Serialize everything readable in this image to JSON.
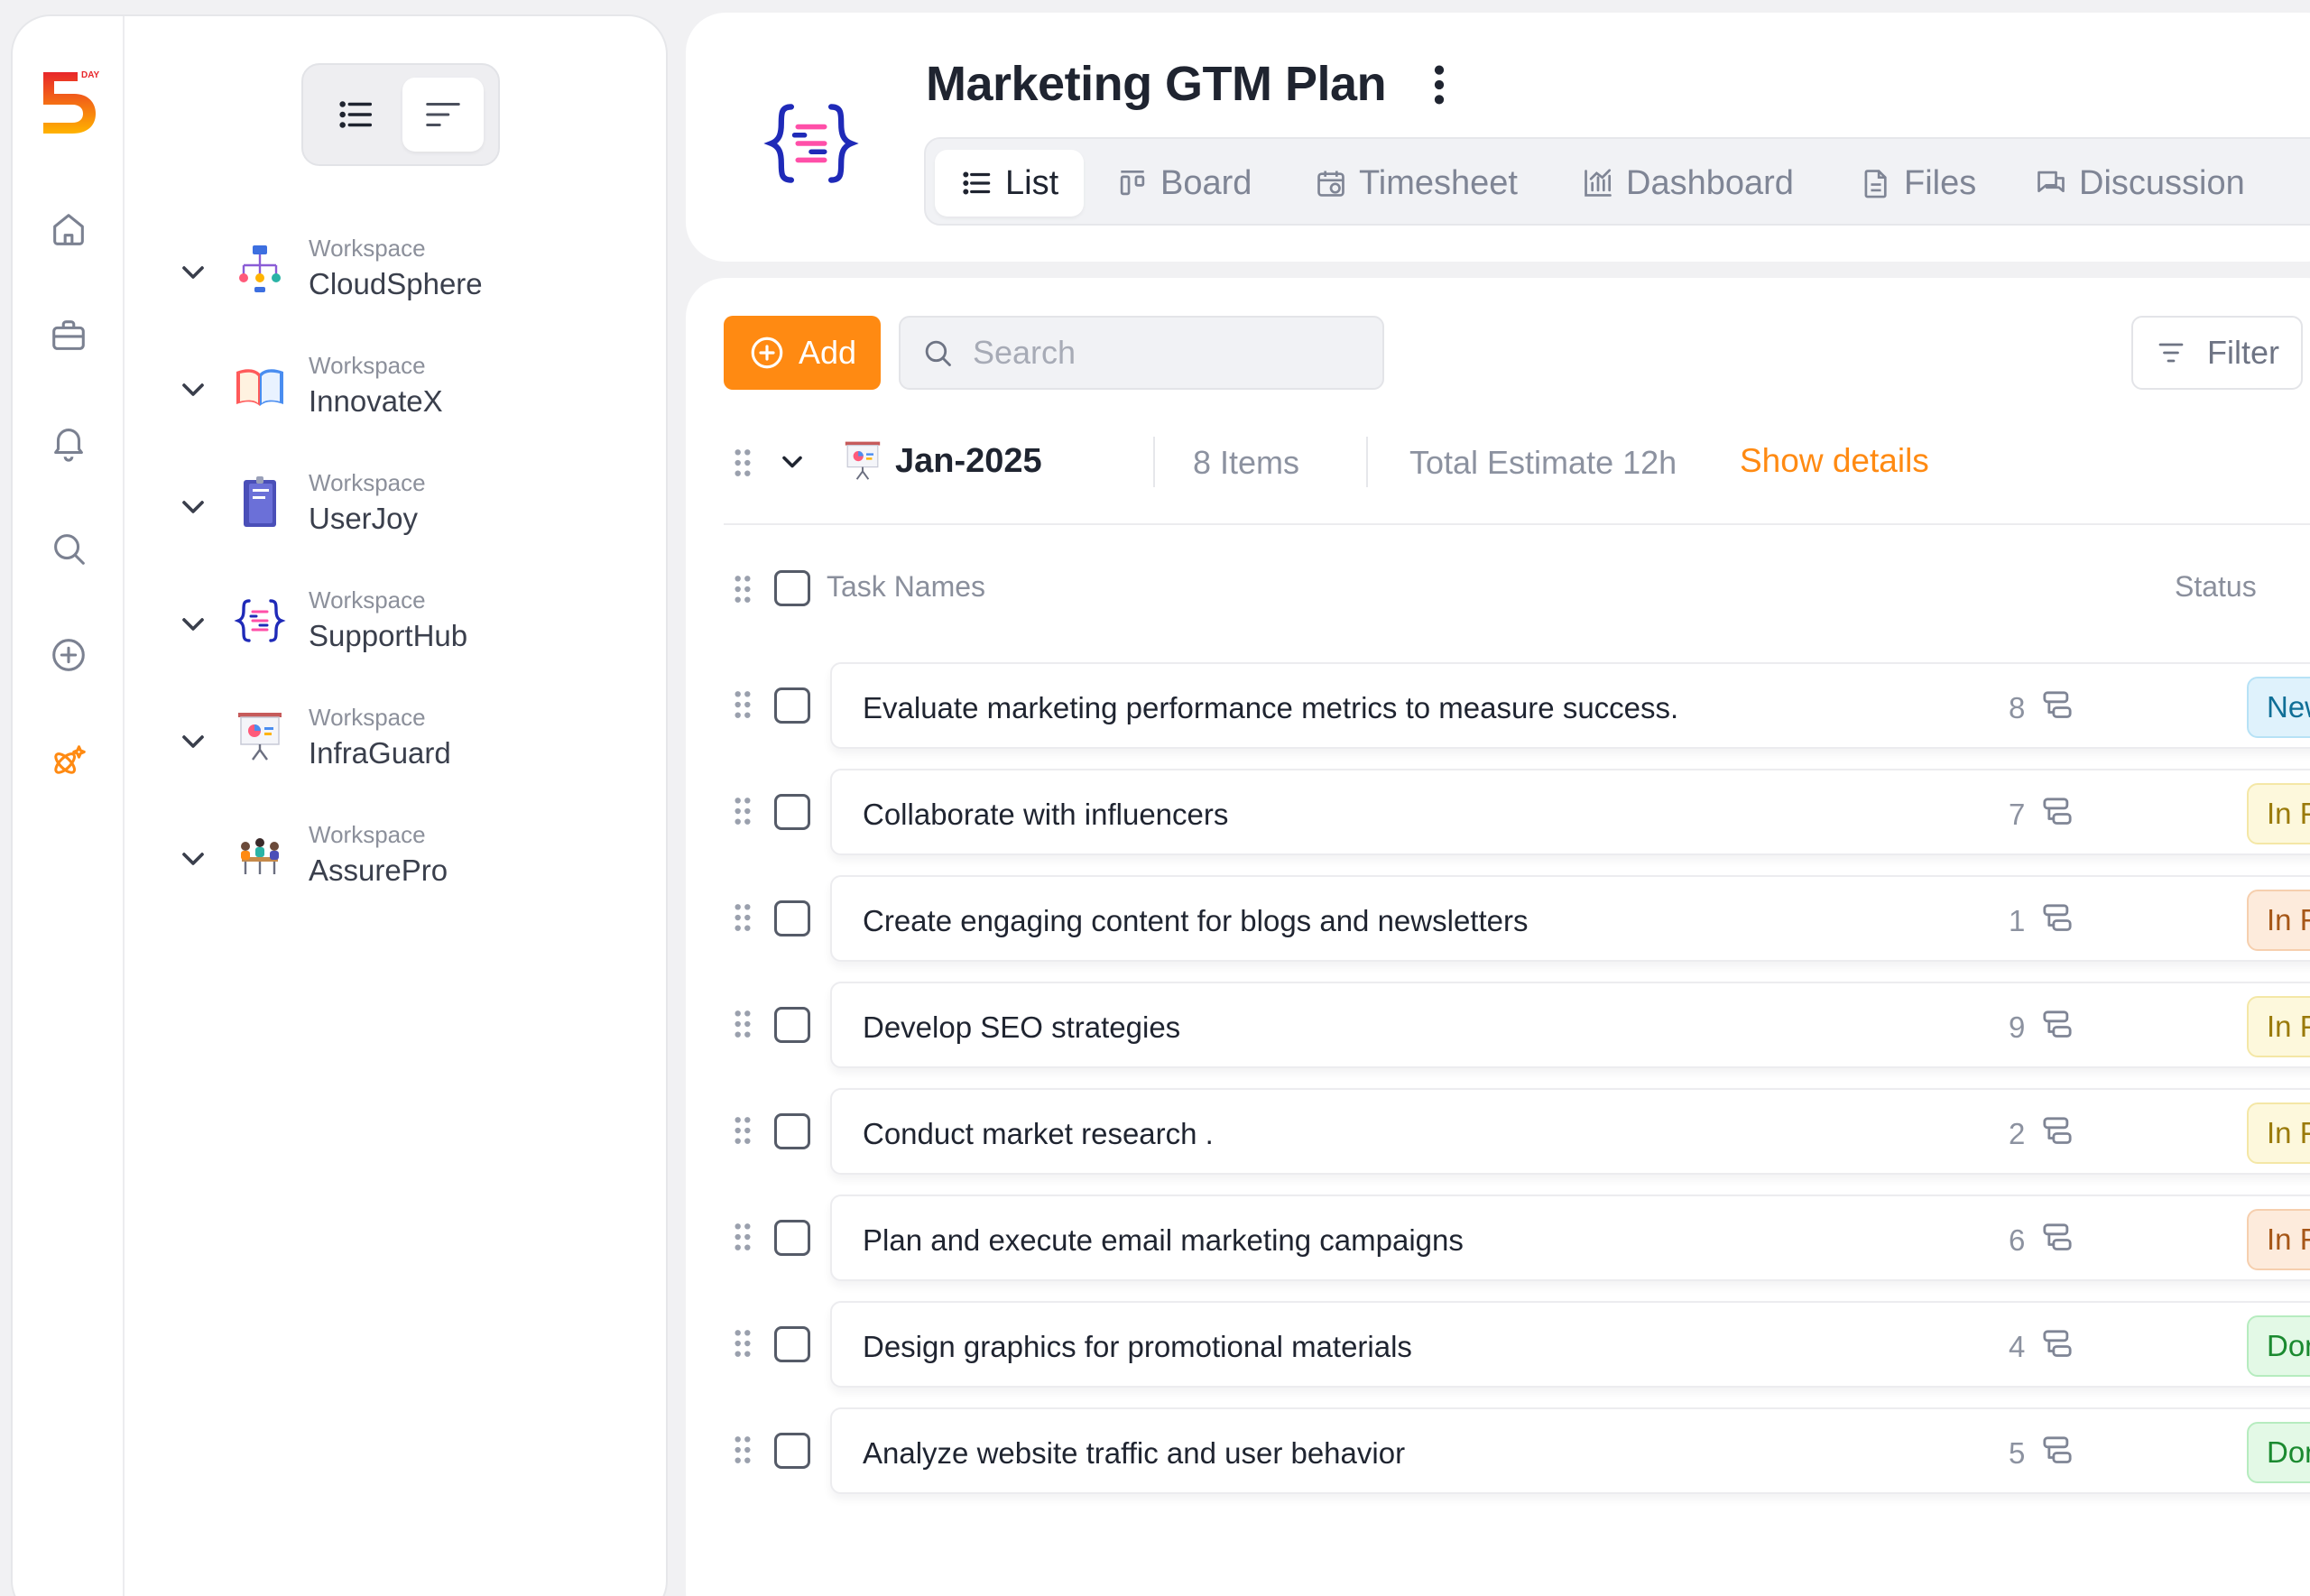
{
  "app": {
    "logo_text": "DAY",
    "logo_number": "5"
  },
  "rail": {
    "icons": [
      "home-icon",
      "briefcase-icon",
      "bell-icon",
      "search-icon",
      "plus-circle-icon",
      "sparkle-icon"
    ],
    "active_color": "#ff8a12"
  },
  "workspaces": [
    {
      "label": "Workspace",
      "name": "CloudSphere",
      "icon": "org-chart-icon"
    },
    {
      "label": "Workspace",
      "name": "InnovateX",
      "icon": "open-book-icon"
    },
    {
      "label": "Workspace",
      "name": "UserJoy",
      "icon": "notebook-icon"
    },
    {
      "label": "Workspace",
      "name": "SupportHub",
      "icon": "braces-icon"
    },
    {
      "label": "Workspace",
      "name": "InfraGuard",
      "icon": "presentation-icon"
    },
    {
      "label": "Workspace",
      "name": "AssurePro",
      "icon": "team-meeting-icon"
    }
  ],
  "project": {
    "title": "Marketing GTM Plan",
    "tabs": [
      {
        "label": "List",
        "active": true
      },
      {
        "label": "Board"
      },
      {
        "label": "Timesheet"
      },
      {
        "label": "Dashboard"
      },
      {
        "label": "Files"
      },
      {
        "label": "Discussion"
      }
    ]
  },
  "toolbar": {
    "add_label": "Add",
    "search_placeholder": "Search",
    "filter_label": "Filter"
  },
  "group": {
    "name": "Jan-2025",
    "items": "8 Items",
    "estimate": "Total Estimate 12h",
    "show_details": "Show details"
  },
  "list_header": {
    "name": "Task Names",
    "status": "Status"
  },
  "tasks": [
    {
      "title": "Evaluate marketing performance metrics to measure success.",
      "count": "8",
      "status": "New"
    },
    {
      "title": "Collaborate with influencers",
      "count": "7",
      "status": "In Progress"
    },
    {
      "title": "Create engaging content for blogs and newsletters",
      "count": "1",
      "status": "In Review"
    },
    {
      "title": "Develop SEO strategies",
      "count": "9",
      "status": "In Progress"
    },
    {
      "title": "Conduct market research .",
      "count": "2",
      "status": "In Progress"
    },
    {
      "title": "Plan and execute email marketing campaigns",
      "count": "6",
      "status": "In Review"
    },
    {
      "title": "Design graphics for promotional materials",
      "count": "4",
      "status": "Done"
    },
    {
      "title": "Analyze website traffic and user behavior",
      "count": "5",
      "status": "Done"
    }
  ],
  "colors": {
    "accent": "#ff8a12",
    "status_new": "#0f6f97",
    "status_progress": "#9a7a0a",
    "status_review": "#a65617",
    "status_done": "#1b8a30"
  }
}
